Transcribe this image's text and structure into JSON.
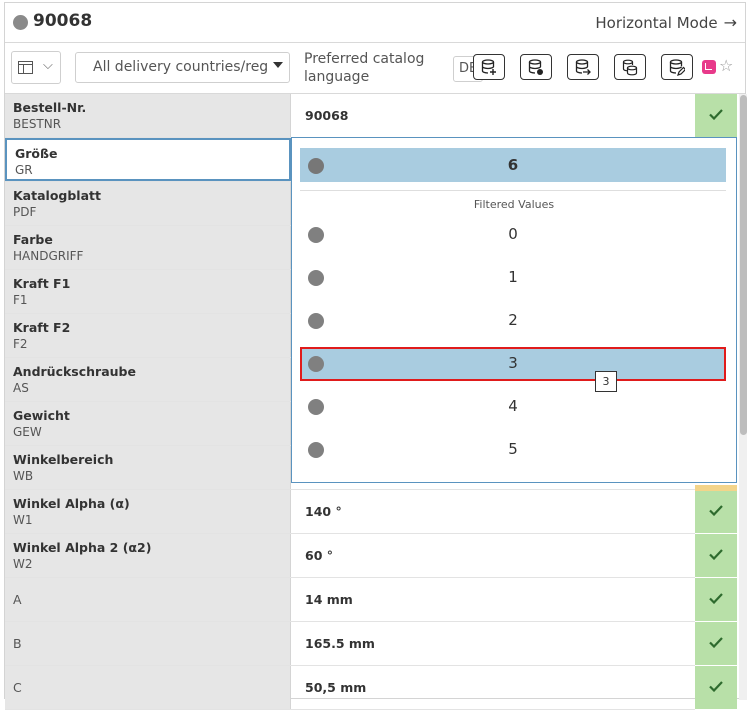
{
  "header": {
    "title": "90068",
    "mode_link": "Horizontal Mode",
    "mode_arrow": "→"
  },
  "toolbar": {
    "country_select": "All delivery countries/regions",
    "lang_label_line1": "Preferred catalog",
    "lang_label_line2": "language",
    "lang_value": "DE",
    "tool_icons": [
      "db-add-icon",
      "db-remove-icon",
      "db-export-icon",
      "db-copy-icon",
      "db-edit-icon"
    ],
    "star": "☆"
  },
  "rows": [
    {
      "name": "Bestell-Nr.",
      "code": "BESTNR",
      "value": "90068",
      "check": true
    },
    {
      "name": "Größe",
      "code": "GR",
      "value": "",
      "check": false
    },
    {
      "name": "Katalogblatt",
      "code": "PDF",
      "value": "",
      "check": false
    },
    {
      "name": "Farbe",
      "code": "HANDGRIFF",
      "value": "",
      "check": false
    },
    {
      "name": "Kraft F1",
      "code": "F1",
      "value": "",
      "check": false
    },
    {
      "name": "Kraft F2",
      "code": "F2",
      "value": "",
      "check": false
    },
    {
      "name": "Andrückschraube",
      "code": "AS",
      "value": "",
      "check": false
    },
    {
      "name": "Gewicht",
      "code": "GEW",
      "value": "",
      "check": false
    },
    {
      "name": "Winkelbereich",
      "code": "WB",
      "value": "",
      "check": false
    },
    {
      "name": "Winkel Alpha (α)",
      "code": "W1",
      "value": "140 °",
      "check": true
    },
    {
      "name": "Winkel Alpha 2 (α2)",
      "code": "W2",
      "value": "60 °",
      "check": true
    },
    {
      "name": "A",
      "code": "",
      "value": "14 mm",
      "check": true
    },
    {
      "name": "B",
      "code": "",
      "value": "165.5 mm",
      "check": true
    },
    {
      "name": "C",
      "code": "",
      "value": "50,5 mm",
      "check": true
    }
  ],
  "dropdown": {
    "current": "6",
    "heading": "Filtered Values",
    "options": [
      "0",
      "1",
      "2",
      "3",
      "4",
      "5"
    ],
    "highlighted_index": 3,
    "tooltip": "3"
  },
  "colors": {
    "selection_blue": "#a9cce0",
    "check_green": "#b8e0a8",
    "highlight_red": "#e01b1b",
    "focus_border": "#5a93bf"
  }
}
